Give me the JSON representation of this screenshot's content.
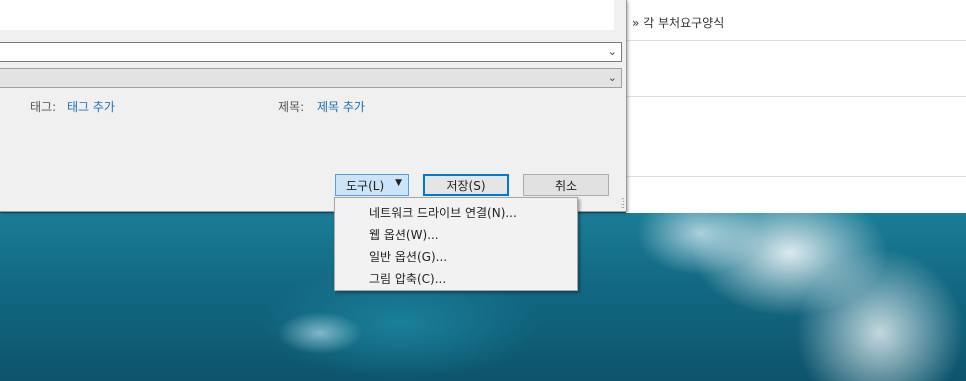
{
  "background_page": {
    "breadcrumb": "» 각 부처요구양식"
  },
  "dialog": {
    "tags_label": "태그:",
    "tags_link": "태그 추가",
    "title_label": "제목:",
    "title_link": "제목 추가",
    "tools_button": "도구(L)",
    "save_button": "저장(S)",
    "cancel_button": "취소"
  },
  "tools_menu": {
    "items": [
      "네트워크 드라이브 연결(N)...",
      "웹 옵션(W)...",
      "일반 옵션(G)...",
      "그림 압축(C)..."
    ]
  }
}
